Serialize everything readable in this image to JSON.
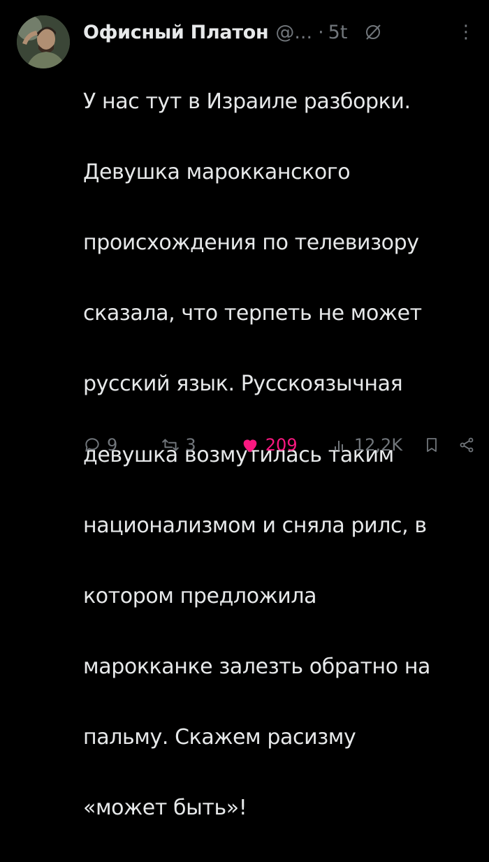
{
  "tweet": {
    "author_name": "Офисный Платон",
    "handle": "@...",
    "separator": "·",
    "time": "5t",
    "more_label": "⋮",
    "lines": [
      "У нас тут в Израиле разборки.",
      "Девушка марокканского",
      "происхождения по телевизору",
      "сказала, что терпеть не может",
      "русский язык. Русскоязычная",
      "девушка возмутилась таким",
      "национализмом и сняла рилс, в",
      "котором предложила",
      "марокканке залезть обратно на",
      "пальму. Скажем расизму",
      "«может быть»!"
    ]
  },
  "actions": {
    "replies": "9",
    "retweets": "3",
    "likes": "209",
    "views": "12,2K"
  },
  "icons": {
    "reply": "reply-icon",
    "retweet": "retweet-icon",
    "like": "heart-icon",
    "views": "views-icon",
    "bookmark": "bookmark-icon",
    "share": "share-icon",
    "grok": "grok-icon",
    "more": "more-icon"
  },
  "colors": {
    "background": "#000000",
    "text": "#e7e9ea",
    "muted": "#71767b",
    "like": "#f91880"
  }
}
